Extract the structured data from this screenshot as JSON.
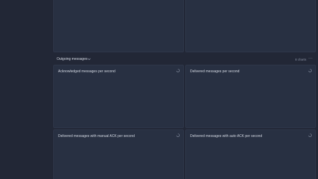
{
  "row": {
    "title": "Outgoing messages",
    "chart_count": "8 charts"
  },
  "panels": [
    {
      "title": ""
    },
    {
      "title": ""
    },
    {
      "title": "Acknowledged messages per second"
    },
    {
      "title": "Delivered messages per second"
    },
    {
      "title": "Delivered messages with manual ACK per second"
    },
    {
      "title": "Delivered messages with auto ACK per second"
    }
  ],
  "icons": {
    "row_chevron": "chevron-down-icon",
    "row_menu": "more-horizontal-icon",
    "panel_loading": "loading-spinner-icon"
  },
  "colors": {
    "background": "#222736",
    "panel": "#283042",
    "text": "#d6dbe5",
    "muted": "#8b93a6"
  }
}
